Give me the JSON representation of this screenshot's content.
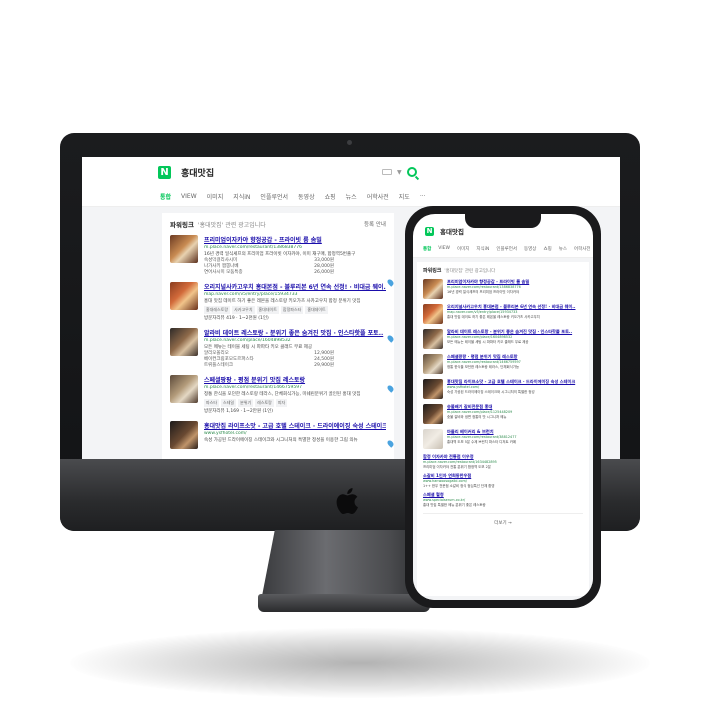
{
  "brand": {
    "accent": "#03c75a",
    "link": "#1a0dab",
    "url": "#2a8a4a"
  },
  "desktop": {
    "query": "홍대맛집",
    "tabs": [
      "통합",
      "VIEW",
      "이미지",
      "지식iN",
      "인플루언서",
      "동영상",
      "쇼핑",
      "뉴스",
      "어학사전",
      "지도",
      "···"
    ],
    "powerlink": {
      "title": "파워링크",
      "subtitle": "'홍대맛집' 관련 광고입니다",
      "right": "등록 안내"
    },
    "ads": [
      {
        "title": "프리미엄이자카야 향정공갑 - 프라이빗 룸 솜밀",
        "url": "m.place.naver.com/restaurant/1386838776",
        "desc": "16년 경력 일식셰프의 프리미엄 프라이빗 이자카야, 이미 재구매, 합정역5번출구",
        "thumb": "t1",
        "rows": [
          {
            "name": "숙성막걸리사시미",
            "price": "33,000원"
          },
          {
            "name": "나가사키 짬뽕나베",
            "price": "28,000원"
          },
          {
            "name": "연어사시미 모둠특종",
            "price": "26,000원"
          }
        ]
      },
      {
        "title": "오리지널사카고우치 홍대본점 - 블루리본 6년 연속 선정! · 비대금 웨이..",
        "url": "map.naver.com/v5/entry/place/15934733",
        "desc": "홍대 맛집 데이트 하기 좋은 레몬을 레스토랑 키오가츠 사카고우치 합정 분위기 맛집",
        "thumb": "t2",
        "tags": [
          "홍대레스토랑",
          "사카고우치",
          "홍대데이트",
          "합정파스타",
          "홍대데이트"
        ],
        "meta": "방문자리뷰 419 · 1~2천원 (1인)"
      },
      {
        "title": "알라비 데이트 레스토랑 - 분위기 좋은 숨겨진 맛집 · 인스타핫플 포토..",
        "url": "m.place.naver.com/place/1604898532",
        "desc": "모든 메뉴는 테이블 세팅 시 파파타 키오 클래드 무료 제공",
        "thumb": "t3",
        "rows": [
          {
            "name": "알리오올리오",
            "price": "12,900원"
          },
          {
            "name": "베이컨크림포모도르파스타",
            "price": "24,500원"
          },
          {
            "name": "트뤼플스테이크",
            "price": "29,900원"
          }
        ]
      },
      {
        "title": "스페셜팡팡 · 평점 분위기 맛집 레스토랑",
        "url": "m.place.naver.com/restaurant/1466759597",
        "desc": "정통 한식을 모던한 레스토랑 테라스, 단체회식가능, 미쉐린분위기 골인된 홍대 맛집",
        "thumb": "t4",
        "tags": [
          "파스타",
          "스테일",
          "분위기",
          "레스토랑",
          "피자"
        ],
        "meta": "방문자리뷰 1,169 · 1~2만원 (1인)"
      },
      {
        "title": "홍대맛집 라이프소맛 - 고급 호텔 스테이크 · 드라이에이징 숙성 스테이크",
        "url": "www.ysfhotel.com/",
        "desc": "숙성 가공된 드라이에이징 스테이크와 시그니처의 특별한 정성을 이용한 그림 의뉴",
        "thumb": "t5"
      }
    ]
  },
  "phone": {
    "query": "홍대맛집",
    "tabs": [
      "통합",
      "VIEW",
      "이미지",
      "지식iN",
      "인플루언서",
      "동영상",
      "쇼핑",
      "뉴스",
      "어학사전",
      "지도"
    ],
    "powerlink": {
      "title": "파워링크",
      "subtitle": "'홍대맛집' 관련 광고입니다"
    },
    "ads": [
      {
        "title": "프리미엄이자카야 향정공갑 - 프라이빗 룸 솜밀",
        "url": "m.place.naver.com/restaurant/1386838776",
        "desc": "16년 경력 일식셰프의 프리미엄 프라이빗 이자카야",
        "thumb": "t1"
      },
      {
        "title": "오리지널사카고우치 홍대본점 - 블루리본 6년 연속 선정! · 비대금 웨이..",
        "url": "map.naver.com/v5/entry/place/15934733",
        "desc": "홍대 맛집 데이트 하기 좋은 레몬을 레스토랑 키오가츠 사카고우치",
        "thumb": "t2"
      },
      {
        "title": "알라비 데이트 레스토랑 - 분위기 좋은 숨겨진 맛집 · 인스타핫플 포토..",
        "url": "m.place.naver.com/place/1604898532",
        "desc": "모든 메뉴는 테이블 세팅 시 파파타 키오 클래드 무료 제공",
        "thumb": "t3"
      },
      {
        "title": "스페셜팡팡 · 평점 분위기 맛집 레스토랑",
        "url": "m.place.naver.com/restaurant/1466759597",
        "desc": "정통 한식을 모던한 레스토랑 테라스, 단체회식가능",
        "thumb": "t4"
      },
      {
        "title": "홍대맛집 라이프소맛 - 고급 호텔 스테이크 · 드라이에이징 숙성 스테이크",
        "url": "www.ysfhotel.com/",
        "desc": "숙성 가공된 드라이에이징 스테이크와 시그니처의 특별한 정성",
        "thumb": "t5"
      },
      {
        "title": "숭불배기 갈비전문점 홍대",
        "url": "m.place.naver.com/place/1125448209",
        "desc": "숯불 갈비와 냉면 정통의 맛 시그니처 메뉴",
        "thumb": "t5"
      },
      {
        "title": "마들리 베이커리 & 브런치",
        "url": "m.place.naver.com/restaurant/38812477",
        "desc": "홍대역 도보 5분 수제 브런치 파스타 디저트 카페",
        "thumb": "t6"
      }
    ],
    "text_ads": [
      {
        "title": "합정 이자카야 전통점 이우정",
        "url": "m.place.naver.com/restaurant/1634482895",
        "desc": "프리미엄 이자카야 전통 분위기 합정역 도보 2분"
      },
      {
        "title": "소갈비 1인자 연희동한우점",
        "url": "www.hanwoosogalbi.com/",
        "desc": "1++ 한우 전문점 소갈비 정식 점심특선 단체 환영"
      },
      {
        "title": "스페셜 혈청",
        "url": "www.specialserum.co.kr/",
        "desc": "홍대 맛집 특별한 메뉴 분위기 좋은 레스토랑"
      }
    ],
    "more": "더보기 →"
  }
}
